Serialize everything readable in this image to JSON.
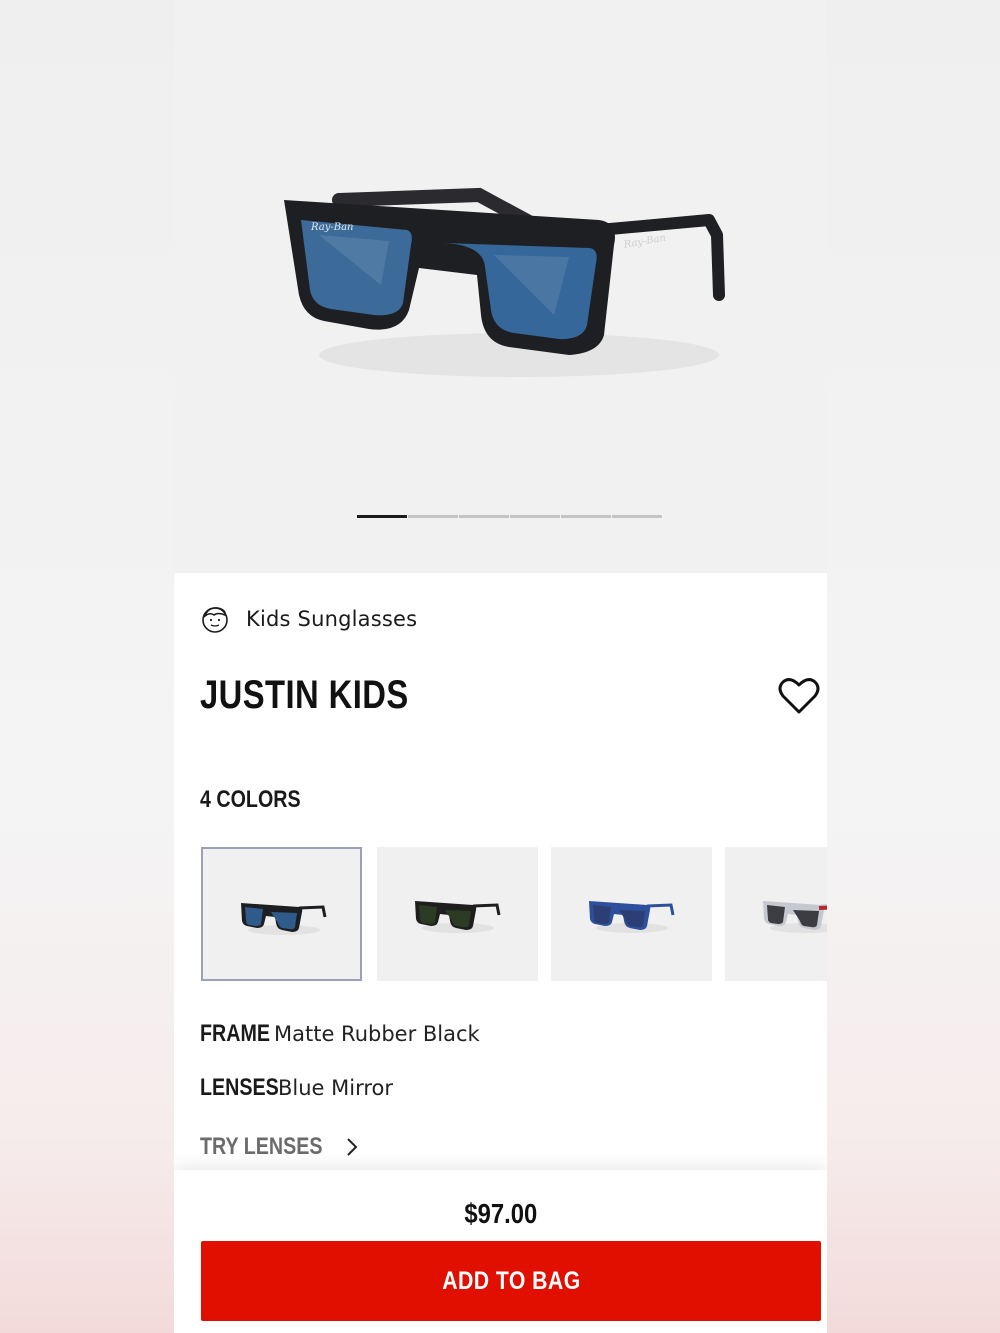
{
  "product": {
    "category": "Kids Sunglasses",
    "name": "JUSTIN KIDS",
    "colors_label": "4 COLORS",
    "frame_label": "FRAME",
    "frame_value": "Matte Rubber Black",
    "lenses_label": "LENSES",
    "lenses_value": "Blue Mirror",
    "try_lenses": "TRY LENSES",
    "price": "$97.00",
    "add_to_bag": "ADD TO BAG"
  },
  "carousel": {
    "total": 6,
    "active": 1
  },
  "swatches": [
    {
      "frame": "#1d1e22",
      "lens": "#2f5b8a",
      "selected": true
    },
    {
      "frame": "#1e1f1d",
      "lens": "#2c3b24",
      "selected": false
    },
    {
      "frame": "#2e4f9c",
      "lens": "#2c3f74",
      "selected": false
    },
    {
      "frame": "#c5c8ce",
      "lens": "#3b3d42",
      "accent": "#b22a2e",
      "selected": false
    }
  ],
  "icons": [
    "kid-face-icon",
    "heart-icon",
    "chevron-right-icon"
  ],
  "colors": {
    "accent": "#e10f00",
    "text": "#111111"
  }
}
